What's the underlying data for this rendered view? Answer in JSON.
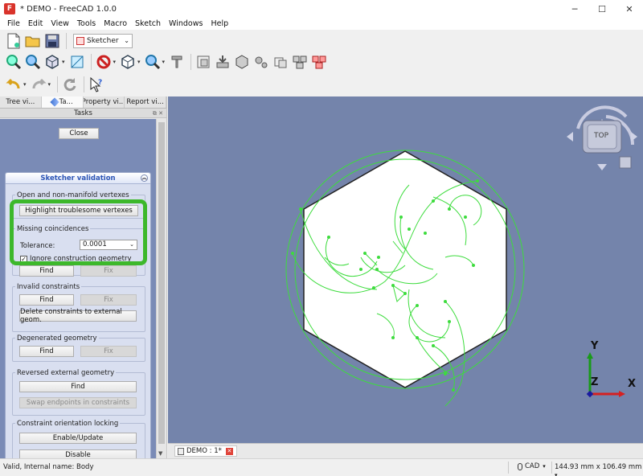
{
  "window": {
    "title": "* DEMO - FreeCAD 1.0.0",
    "app_icon_letter": "F",
    "minimize": "─",
    "maximize": "☐",
    "close": "✕"
  },
  "menu": [
    "File",
    "Edit",
    "View",
    "Tools",
    "Macro",
    "Sketch",
    "Windows",
    "Help"
  ],
  "workbench": {
    "selected": "Sketcher"
  },
  "dock": {
    "tabs": [
      "Tree vi...",
      "Ta...",
      "Property vi...",
      "Report vi..."
    ],
    "active_tab": 1,
    "tasks_title": "Tasks",
    "close_label": "Close"
  },
  "validation": {
    "title": "Sketcher validation",
    "open_vertexes": {
      "title": "Open and non-manifold vertexes",
      "highlight_btn": "Highlight troublesome vertexes"
    },
    "missing": {
      "title": "Missing coincidences",
      "tolerance_label": "Tolerance:",
      "tolerance_value": "0.0001",
      "ignore_label": "Ignore construction geometry",
      "ignore_checked": true,
      "find": "Find",
      "fix": "Fix"
    },
    "invalid": {
      "title": "Invalid constraints",
      "find": "Find",
      "fix": "Fix",
      "delete_btn": "Delete constraints to external geom."
    },
    "degenerated": {
      "title": "Degenerated geometry",
      "find": "Find",
      "fix": "Fix"
    },
    "reversed": {
      "title": "Reversed external geometry",
      "find": "Find",
      "swap_btn": "Swap endpoints in constraints"
    },
    "locking": {
      "title": "Constraint orientation locking",
      "enable_btn": "Enable/Update",
      "disable_btn": "Disable"
    }
  },
  "view": {
    "navcube_face": "TOP",
    "axes": {
      "x": "X",
      "y": "Y",
      "z": "Z"
    },
    "colors": {
      "background": "#7484ab",
      "sketch": "#3ddc3d",
      "solid": "#ffffff",
      "axis_x": "#d62020",
      "axis_y": "#1a9a1a",
      "axis_z": "#1a1aa0"
    }
  },
  "view_tab": {
    "label": "DEMO : 1*"
  },
  "status": {
    "text": "Valid, Internal name: Body",
    "nav_style": "CAD",
    "dimensions": "144.93 mm x 106.49 mm"
  }
}
